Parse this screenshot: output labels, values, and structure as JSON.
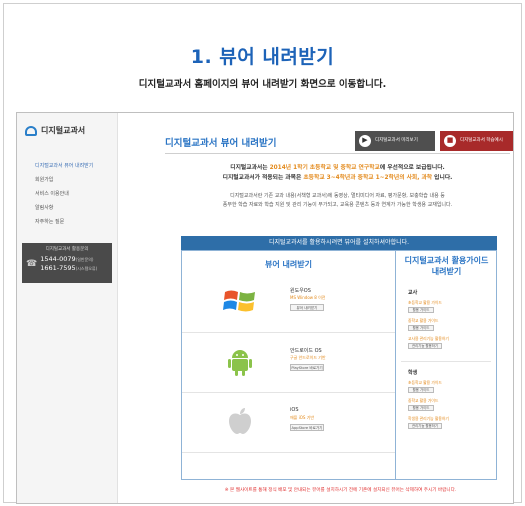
{
  "page": {
    "title": "1. 뷰어 내려받기",
    "subtitle": "디지털교과서 홈페이지의 뷰어 내려받기 화면으로 이동합니다."
  },
  "sidebar": {
    "logo_text": "디지털교과서",
    "items": [
      {
        "label": "디지털교과서 뷰어 내려받기"
      },
      {
        "label": "회원가입"
      },
      {
        "label": "서비스 이용안내"
      },
      {
        "label": "알림사항"
      },
      {
        "label": "자주하는 질문"
      }
    ],
    "callbox": {
      "title": "디지털교과서 활용문의",
      "phone1": "1544-0079",
      "phone1_note": "(일반문의)",
      "phone2": "1661-7595",
      "phone2_note": "(시스템오류)"
    }
  },
  "main": {
    "title": "디지털교과서 뷰어 내려받기",
    "btn_preview": "디지털교과서 미리보기",
    "btn_guide": "디지털교과서 학습예시",
    "intro_line1_a": "디지털교과서는 ",
    "intro_line1_b": "2014년 1학기 초등학교 및 중학교 연구학교",
    "intro_line1_c": "에 우선적으로 보급됩니다.",
    "intro_line2_a": "디지털교과서가 적용되는 과목은 ",
    "intro_line2_b": "초등학교 3~4학년과 중학교 1~2학년의 사회, 과학",
    "intro_line2_c": " 입니다.",
    "desc_line1": "디지털교과서란 기존 교과 내용(서책형 교과서)에 동영상, 멀티미디어 자료, 평가문항, 보충학습 내용 등",
    "desc_line2": "풍부한 학습 자료와 학습 지원 및 관리 기능이 부가되고, 교육용 콘텐츠 등과 연계가 가능한 학생용 교재입니다.",
    "install_bar": "디지털교과서를 활용하시려면 뷰어를 설치하셔야합니다.",
    "viewer_title": "뷰어 내려받기",
    "os": [
      {
        "name": "윈도우OS",
        "req": "MS Window 8 이전",
        "btn": "뷰어 내려받기",
        "icon": "windows-logo-icon"
      },
      {
        "name": "안드로이드 OS",
        "req": "구글 안드로이드 기반",
        "btn": "PlayStore 바로가기",
        "icon": "android-logo-icon"
      },
      {
        "name": "iOS",
        "req": "애플 iOS 기반",
        "btn": "AppStore 바로가기",
        "icon": "apple-logo-icon"
      }
    ],
    "guide_title_1": "디지털교과서 활용가이드",
    "guide_title_2": "내려받기",
    "teacher_label": "교사",
    "teacher_items": [
      {
        "label": "초등학교 활용 가이드",
        "btn": "활용 가이드"
      },
      {
        "label": "중학교 활용 가이드",
        "btn": "활용 가이드"
      },
      {
        "label": "교사용 관리기능 활용하기",
        "btn": "관리기능 활용하기"
      }
    ],
    "student_label": "학생",
    "student_items": [
      {
        "label": "초등학교 활용 가이드",
        "btn": "활용 가이드"
      },
      {
        "label": "중학교 활용 가이드",
        "btn": "활용 가이드"
      },
      {
        "label": "학생용 관리기능 활용하기",
        "btn": "관리기능 활용하기"
      }
    ],
    "footnote": "※ 본 웹사이트를 통해 정식 배포 및 안내되는 뷰어를 설치하시기 전에 기존에 설치되신 뷰어는 삭제하여 주시기 바랍니다."
  },
  "colors": {
    "accent_blue": "#2a74c4",
    "orange": "#e38a1c",
    "install_bar": "#2e6ea8",
    "guide_red": "#a82a2a"
  }
}
